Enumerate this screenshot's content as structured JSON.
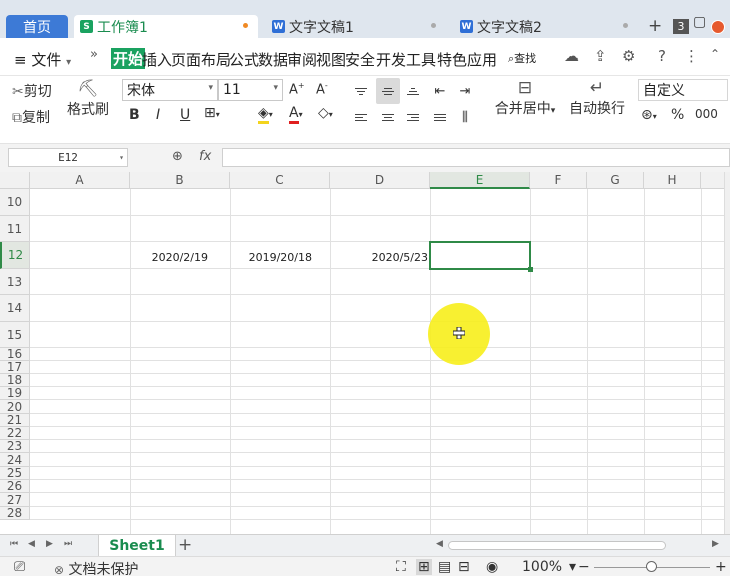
{
  "tabs": {
    "home": "首页",
    "workbook": "工作簿1",
    "doc1": "文字文稿1",
    "doc2": "文字文稿2",
    "window_count": "3"
  },
  "menu": {
    "file": "文件",
    "items": [
      "开始",
      "插入",
      "页面布局",
      "公式",
      "数据",
      "审阅",
      "视图",
      "安全",
      "开发工具",
      "特色应用"
    ],
    "search": "查找"
  },
  "ribbon": {
    "cut": "剪切",
    "copy": "复制",
    "format_painter": "格式刷",
    "font_name": "宋体",
    "font_size": "11",
    "bold": "B",
    "italic": "I",
    "underline": "U",
    "merge_center": "合并居中",
    "wrap_text": "自动换行",
    "number_format": "自定义",
    "percent": "%"
  },
  "formula_bar": {
    "name_box": "E12",
    "fx": "fx",
    "value": ""
  },
  "grid": {
    "columns": [
      "A",
      "B",
      "C",
      "D",
      "E",
      "F",
      "G",
      "H"
    ],
    "rows": [
      "10",
      "11",
      "12",
      "13",
      "14",
      "15",
      "16",
      "17",
      "18",
      "19",
      "20",
      "21",
      "22",
      "23",
      "24",
      "25",
      "26",
      "27",
      "28"
    ],
    "selected_cell": "E12",
    "cells": {
      "B12": "2020/2/19",
      "C12": "2019/20/18",
      "D12": "2020/5/23"
    }
  },
  "sheet_tabs": {
    "active": "Sheet1",
    "add": "+"
  },
  "status": {
    "protection": "文档未保护",
    "zoom": "100%"
  }
}
